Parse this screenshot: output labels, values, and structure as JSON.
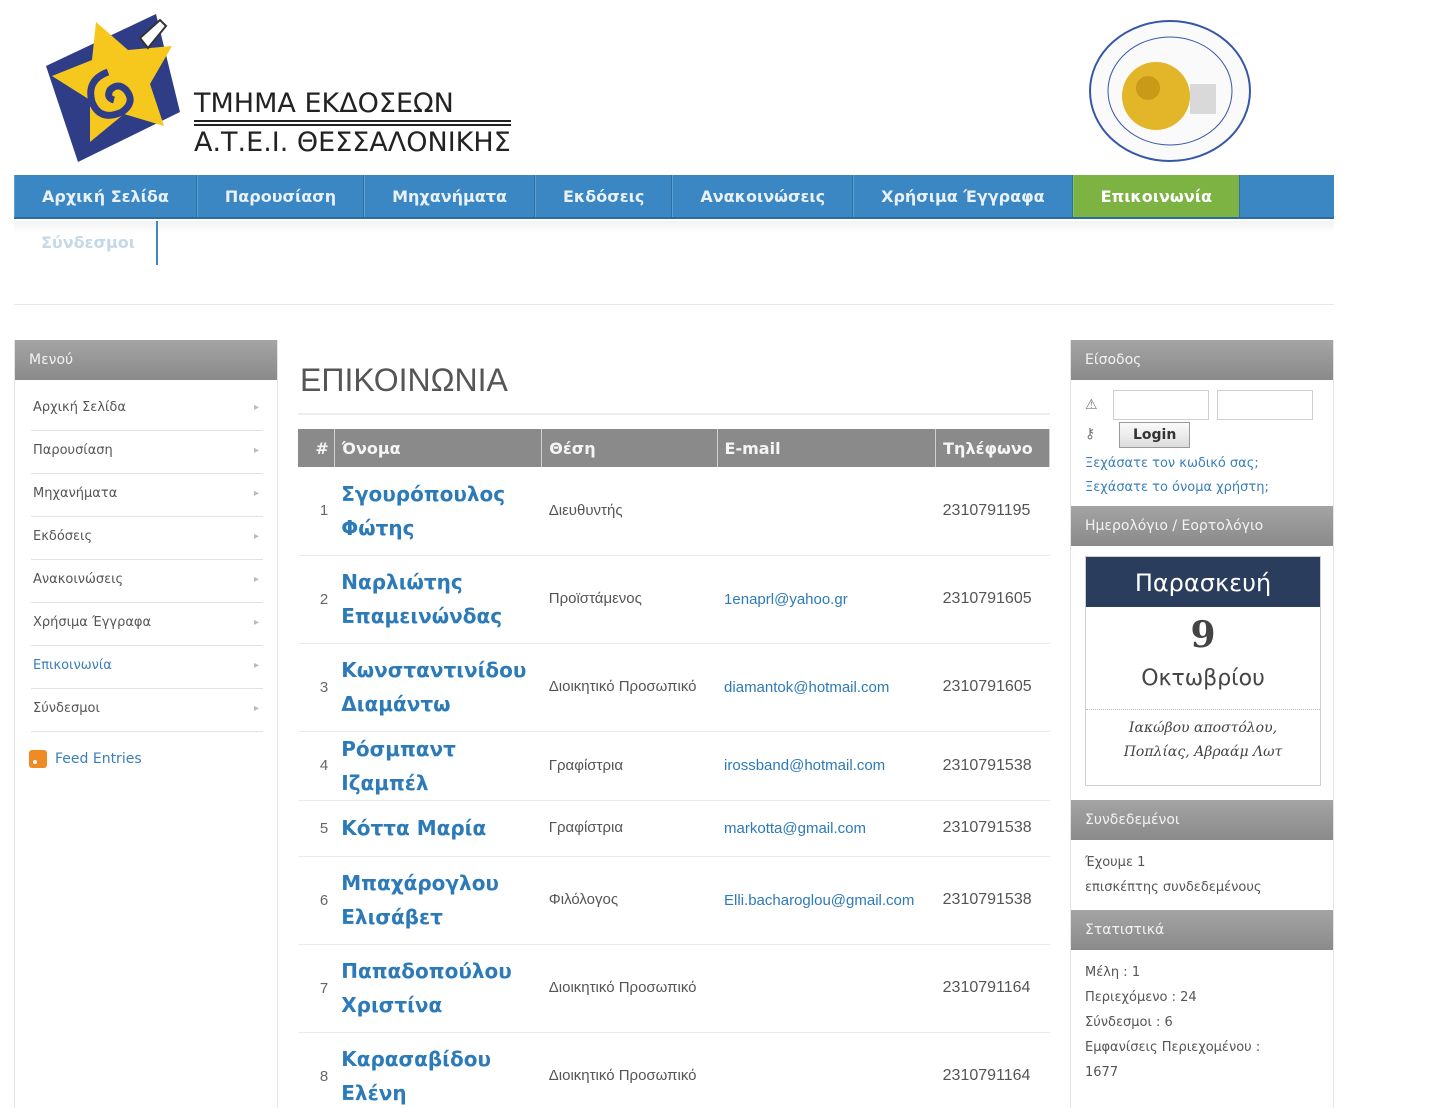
{
  "header": {
    "line1": "ΤΜΗΜΑ ΕΚΔΟΣΕΩΝ",
    "line2": "Α.Τ.Ε.Ι. ΘΕΣΣΑΛΟΝΙΚΗΣ"
  },
  "nav": {
    "items": [
      "Αρχική Σελίδα",
      "Παρουσίαση",
      "Μηχανήματα",
      "Εκδόσεις",
      "Ανακοινώσεις",
      "Χρήσιμα Έγγραφα",
      "Επικοινωνία"
    ],
    "active": "Επικοινωνία",
    "sub": "Σύνδεσμοι"
  },
  "left": {
    "title": "Μενού",
    "items": [
      "Αρχική Σελίδα",
      "Παρουσίαση",
      "Μηχανήματα",
      "Εκδόσεις",
      "Ανακοινώσεις",
      "Χρήσιμα Έγγραφα",
      "Επικοινωνία",
      "Σύνδεσμοι"
    ],
    "feed": "Feed Entries"
  },
  "main": {
    "title": "ΕΠΙΚΟΙΝΩΝΙΑ",
    "columns": [
      "#",
      "Όνομα",
      "Θέση",
      "E-mail",
      "Τηλέφωνο"
    ],
    "rows": [
      {
        "n": "1",
        "name": "Σγουρόπουλος Φώτης",
        "pos": "Διευθυντής",
        "mail": "",
        "tel": "2310791195"
      },
      {
        "n": "2",
        "name": "Ναρλιώτης Επαμεινώνδας",
        "pos": "Προϊστάμενος",
        "mail": "1enaprl@yahoo.gr",
        "tel": "2310791605"
      },
      {
        "n": "3",
        "name": "Κωνσταντινίδου Διαμάντω",
        "pos": "Διοικητικό Προσωπικό",
        "mail": "diamantok@hotmail.com",
        "tel": "2310791605"
      },
      {
        "n": "4",
        "name": "Ρόσμπαντ Ιζαμπέλ",
        "pos": "Γραφίστρια",
        "mail": "irossband@hotmail.com",
        "tel": "2310791538"
      },
      {
        "n": "5",
        "name": "Κόττα Μαρία",
        "pos": "Γραφίστρια",
        "mail": "markotta@gmail.com",
        "tel": "2310791538"
      },
      {
        "n": "6",
        "name": "Μπαχάρογλου Ελισάβετ",
        "pos": "Φιλόλογος",
        "mail": "Elli.bacharoglou@gmail.com",
        "tel": "2310791538"
      },
      {
        "n": "7",
        "name": "Παπαδοπούλου Χριστίνα",
        "pos": "Διοικητικό Προσωπικό",
        "mail": "",
        "tel": "2310791164"
      },
      {
        "n": "8",
        "name": "Καρασαβίδου Ελένη",
        "pos": "Διοικητικό Προσωπικό",
        "mail": "",
        "tel": "2310791164"
      }
    ]
  },
  "right": {
    "login_title": "Είσοδος",
    "login_button": "Login",
    "forgot_password": "Ξεχάσατε τον κωδικό σας;",
    "forgot_username": "Ξεχάσατε το όνομα χρήστη;",
    "calendar_title": "Ημερολόγιο / Εορτολόγιο",
    "cal_day": "Παρασκευή",
    "cal_date": "9",
    "cal_month": "Οκτωβρίου",
    "cal_names_1": "Ιακώβου αποστόλου,",
    "cal_names_2": "Ποπλίας, Αβραάμ Λωτ",
    "online_title": "Συνδεδεμένοι",
    "online_1": "Έχουμε 1",
    "online_2": "επισκέπτης συνδεδεμένους",
    "stats_title": "Στατιστικά",
    "stats": [
      "Μέλη : 1",
      "Περιεχόμενο : 24",
      "Σύνδεσμοι : 6",
      "Εμφανίσεις Περιεχομένου :",
      "1677"
    ]
  }
}
